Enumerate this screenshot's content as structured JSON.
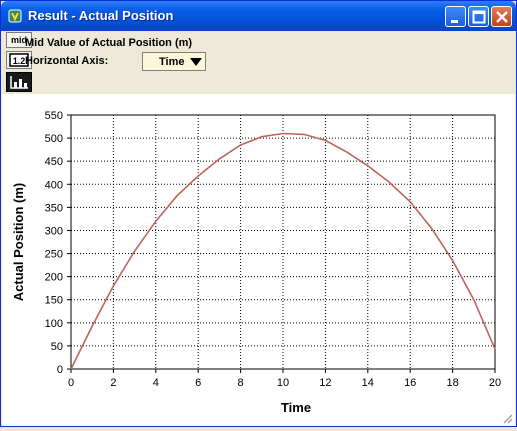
{
  "window": {
    "title": "Result - Actual Position"
  },
  "toolbar": {
    "mid_button_label": "mid",
    "format_button_label": "1.2",
    "graph_button_label": "graph",
    "info_title": "Mid Value of Actual Position (m)",
    "horizontal_axis_label": "Horizontal Axis:",
    "horizontal_axis_value": "Time"
  },
  "icons": [
    "app-icon",
    "minimize-icon",
    "maximize-icon",
    "close-icon",
    "chevron-down-icon",
    "number-format-icon",
    "graph-icon",
    "resize-grip-icon"
  ],
  "colors": {
    "line": "#c0645a",
    "titlebar": "#0550d8"
  },
  "chart_data": {
    "type": "line",
    "xlabel": "Time",
    "ylabel": "Actual Position (m)",
    "xlim": [
      0,
      20
    ],
    "ylim": [
      0,
      550
    ],
    "xticks": [
      0,
      2,
      4,
      6,
      8,
      10,
      12,
      14,
      16,
      18,
      20
    ],
    "yticks": [
      0,
      50,
      100,
      150,
      200,
      250,
      300,
      350,
      400,
      450,
      500,
      550
    ],
    "grid": true,
    "series": [
      {
        "x": [
          0,
          1,
          2,
          3,
          4,
          5,
          6,
          7,
          8,
          9,
          10,
          11,
          12,
          13,
          14,
          15,
          16,
          17,
          18,
          19,
          20
        ],
        "y": [
          0,
          93,
          180,
          255,
          320,
          375,
          418,
          455,
          485,
          503,
          510,
          508,
          495,
          470,
          440,
          405,
          362,
          305,
          235,
          150,
          43
        ]
      }
    ]
  }
}
